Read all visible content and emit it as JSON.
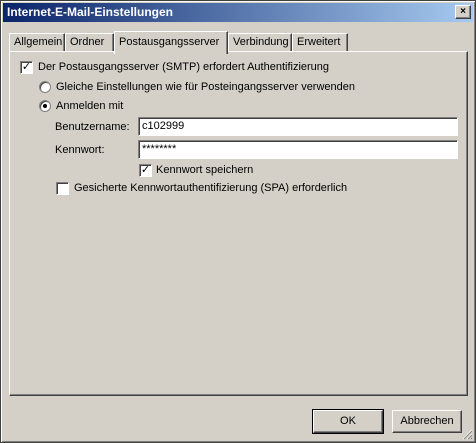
{
  "window": {
    "title": "Internet-E-Mail-Einstellungen",
    "close_glyph": "×"
  },
  "tabs": [
    {
      "label": "Allgemein"
    },
    {
      "label": "Ordner"
    },
    {
      "label": "Postausgangsserver",
      "active": true
    },
    {
      "label": "Verbindung"
    },
    {
      "label": "Erweitert"
    }
  ],
  "auth": {
    "requires_auth_label": "Der Postausgangsserver (SMTP) erfordert Authentifizierung",
    "requires_auth_checked": true,
    "same_settings_label": "Gleiche Einstellungen wie für Posteingangsserver verwenden",
    "login_with_label": "Anmelden mit",
    "username_label": "Benutzername:",
    "username_value": "c102999",
    "password_label": "Kennwort:",
    "password_value": "********",
    "save_password_label": "Kennwort speichern",
    "save_password_checked": true,
    "spa_label": "Gesicherte Kennwortauthentifizierung (SPA) erforderlich",
    "spa_checked": false
  },
  "buttons": {
    "ok": "OK",
    "cancel": "Abbrechen"
  },
  "colors": {
    "face": "#d4d0c8",
    "title_start": "#0a246a",
    "title_end": "#a6caf0"
  }
}
